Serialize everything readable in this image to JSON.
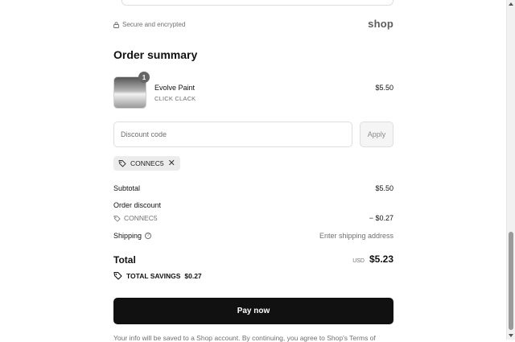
{
  "security": {
    "text": "Secure and encrypted"
  },
  "shop_logo": "shop",
  "order_summary": {
    "title": "Order summary",
    "product": {
      "name": "Evolve Paint",
      "variant": "CLICK CLACK",
      "price": "$5.50",
      "quantity": "1"
    },
    "discount": {
      "placeholder": "Discount code",
      "apply_label": "Apply",
      "applied_code": "CONNEC5"
    },
    "rows": {
      "subtotal_label": "Subtotal",
      "subtotal_value": "$5.50",
      "order_discount_label": "Order discount",
      "order_discount_code": "CONNEC5",
      "order_discount_value": "− $0.27",
      "shipping_label": "Shipping",
      "shipping_value": "Enter shipping address"
    },
    "total": {
      "label": "Total",
      "currency": "USD",
      "amount": "$5.23"
    },
    "savings": {
      "label": "TOTAL SAVINGS",
      "amount": "$0.27"
    }
  },
  "pay_button": "Pay now",
  "fineprint": "Your info will be saved to a Shop account. By continuing, you agree to Shop's Terms of"
}
